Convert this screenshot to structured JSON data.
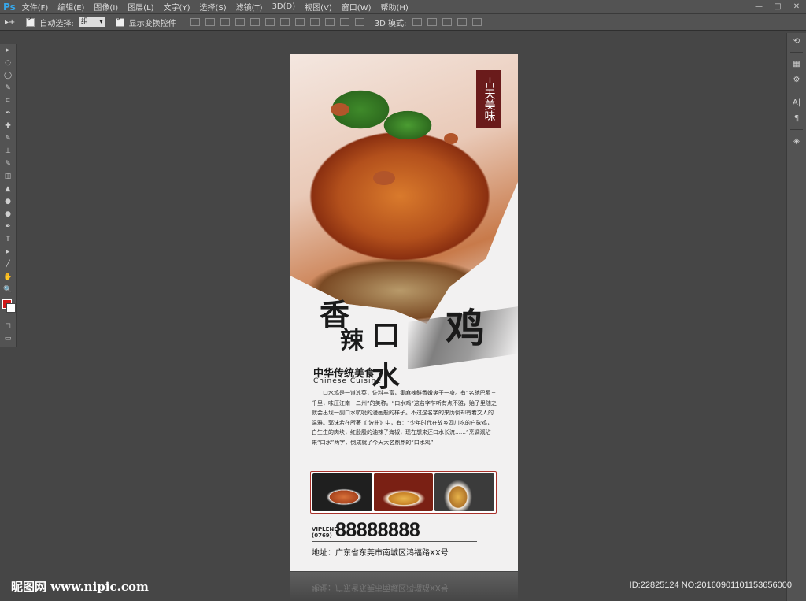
{
  "app": {
    "logo": "Ps"
  },
  "menu": [
    "文件(F)",
    "编辑(E)",
    "图像(I)",
    "图层(L)",
    "文字(Y)",
    "选择(S)",
    "滤镜(T)",
    "3D(D)",
    "视图(V)",
    "窗口(W)",
    "帮助(H)"
  ],
  "window_controls": {
    "minimize": "—",
    "maximize": "□",
    "close": "✕"
  },
  "options": {
    "tool_icon": "▸+",
    "auto_select_label": "自动选择:",
    "auto_select_value": "组",
    "show_transform_label": "显示变换控件",
    "mode_3d_label": "3D 模式:"
  },
  "tools": [
    "move-tool",
    "marquee-tool",
    "lasso-tool",
    "quick-select-tool",
    "crop-tool",
    "eyedropper-tool",
    "healing-tool",
    "brush-tool",
    "stamp-tool",
    "history-brush-tool",
    "eraser-tool",
    "gradient-tool",
    "blur-tool",
    "dodge-tool",
    "pen-tool",
    "type-tool",
    "path-select-tool",
    "line-tool",
    "hand-tool",
    "zoom-tool",
    "quick-mask",
    "screen-mode"
  ],
  "tool_glyphs": [
    "▸",
    "◌",
    "◯",
    "✎",
    "⌗",
    "✒",
    "✚",
    "✎",
    "⊥",
    "✎",
    "◫",
    "▲",
    "●",
    "●",
    "✒",
    "T",
    "▸",
    "╱",
    "✋",
    "🔍",
    "◻",
    "▭"
  ],
  "colors": {
    "foreground": "#d01818",
    "background": "#ffffff",
    "accent": "#6a1b1b"
  },
  "right_panel": [
    "history-icon",
    "layers-icon",
    "adjust-icon",
    "text-icon",
    "paragraph-icon",
    "3d-icon"
  ],
  "right_panel_glyphs": [
    "⟲",
    "▦",
    "⚙",
    "A|",
    "¶",
    "◈"
  ],
  "poster": {
    "stamp_text": "古天美味",
    "title_chars": [
      "香",
      "辣",
      "口水",
      "鸡"
    ],
    "subtitle": "中华传统美食",
    "subtitle_en": "Chinese Cuisine",
    "body": "口水鸡是一道凉菜，佐料丰富，集麻辣鲜香嫩爽于一身。有“名驰巴蜀三千里，味压江南十二州”的美称。“口水鸡”这名字乍听有点不雅，贻子里随之就会出现一副口水吭吮的漫画般的样子。不过这名字的来历倒却有着文人的温雅。郭沫若在所著《 波曲》中，有：“少年时代在故乡四川吃的白砍鸡，白生生的肉块，红殷殷的油辣子海椒，现在想来还口水长流……”烹调溉沾来“口水”两字，倒成就了今天大名鼎鼎的“口水鸡”",
    "phone_label_top": "VIPLENE",
    "phone_label_bottom": "(0769)",
    "phone_number": "88888888",
    "address": "地址：广东省东莞市南城区鸿福路XX号"
  },
  "watermark": {
    "left": "昵图网 www.nipic.com",
    "right": "ID:22825124 NO:20160901101153656000"
  }
}
